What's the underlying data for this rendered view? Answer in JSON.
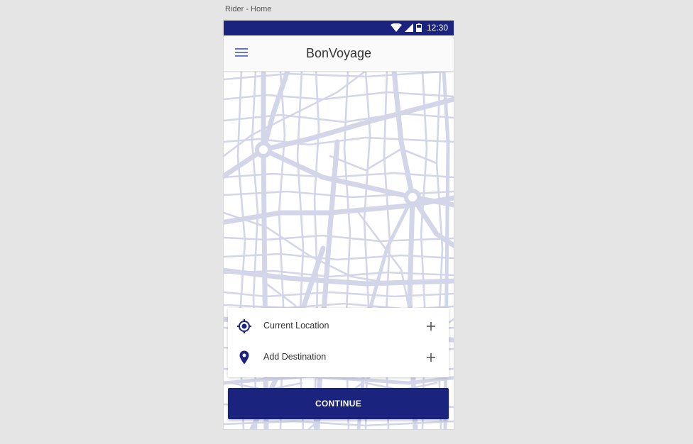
{
  "artboard": {
    "label": "Rider - Home"
  },
  "status_bar": {
    "time": "12:30",
    "icons": [
      "wifi-icon",
      "cell-signal-icon",
      "battery-icon"
    ],
    "background": "#1a237e"
  },
  "app_bar": {
    "title": "BonVoyage",
    "menu_icon": "hamburger-menu-icon"
  },
  "map": {
    "road_color": "#d3d5e9",
    "block_color": "#ffffff"
  },
  "locations": [
    {
      "label": "Current Location",
      "icon": "gps-crosshair-icon",
      "action_icon": "plus-icon"
    },
    {
      "label": "Add Destination",
      "icon": "map-pin-icon",
      "action_icon": "plus-icon"
    }
  ],
  "continue_button": {
    "label": "CONTINUE",
    "color": "#1a237e"
  },
  "colors": {
    "primary": "#1a237e",
    "canvas": "#e5e5e5"
  }
}
